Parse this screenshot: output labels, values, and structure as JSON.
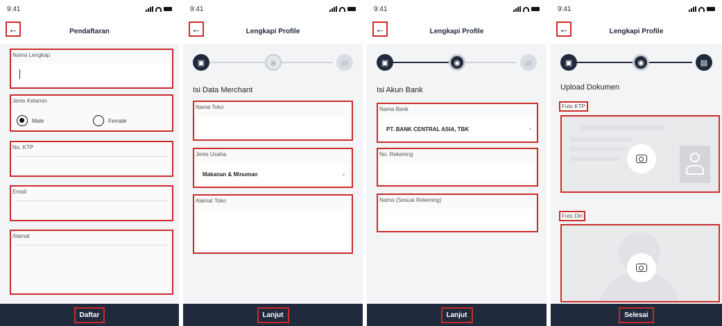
{
  "status_time": "9:41",
  "colors": {
    "highlight": "#cc2a2a",
    "primary": "#1f2a3c",
    "background": "#f3f4f6"
  },
  "screen1": {
    "title": "Pendaftaran",
    "fields": {
      "nama_lengkap": "Nama Lengkap",
      "jenis_kelamin": "Jenis Kelamin",
      "male": "Male",
      "female": "Female",
      "selected_gender": "Male",
      "no_ktp": "No. KTP",
      "email": "Email",
      "alamat": "Alamat"
    },
    "button": "Daftar"
  },
  "screen2": {
    "title": "Lengkapi Profile",
    "section": "Isi Data Merchant",
    "fields": {
      "nama_toko": "Nama Toko",
      "jenis_usaha": "Jenis Usaha",
      "jenis_usaha_value": "Makanan & Minuman",
      "alamat_toko": "Alamat Toko"
    },
    "button": "Lanjut"
  },
  "screen3": {
    "title": "Lengkapi Profile",
    "section": "Isi Akun Bank",
    "fields": {
      "nama_bank": "Nama Bank",
      "nama_bank_value": "PT. BANK CENTRAL ASIA, TBK",
      "no_rekening": "No. Rekening",
      "nama_rekening": "Nama (Sesuai Rekening)"
    },
    "button": "Lanjut"
  },
  "screen4": {
    "title": "Lengkapi Profile",
    "section": "Upload Dokumen",
    "foto_ktp": "Foto KTP",
    "foto_diri": "Foto Diri",
    "button": "Selesai"
  }
}
